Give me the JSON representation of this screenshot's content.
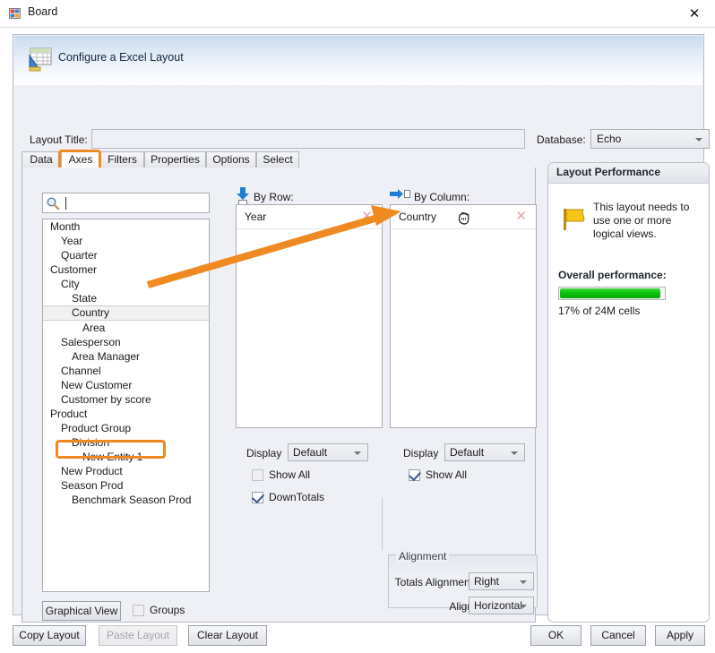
{
  "window": {
    "title": "Board",
    "icon": "board-app-icon",
    "close_label": "✕"
  },
  "banner": {
    "title": "Configure a Excel Layout",
    "icon": "excel-layout-icon"
  },
  "form": {
    "layout_title_label": "Layout Title:",
    "layout_title_value": "",
    "database_label": "Database:",
    "database_value": "Echo"
  },
  "tabs": [
    {
      "label": "Data",
      "selected": false
    },
    {
      "label": "Axes",
      "selected": true
    },
    {
      "label": "Filters",
      "selected": false
    },
    {
      "label": "Properties",
      "selected": false
    },
    {
      "label": "Options",
      "selected": false
    },
    {
      "label": "Select",
      "selected": false
    }
  ],
  "search": {
    "value": "",
    "placeholder": "",
    "icon": "magnifier-icon"
  },
  "tree": {
    "items": [
      {
        "label": "Month",
        "indent": 0,
        "selected": false
      },
      {
        "label": "Year",
        "indent": 1,
        "selected": false
      },
      {
        "label": "Quarter",
        "indent": 1,
        "selected": false
      },
      {
        "label": "Customer",
        "indent": 0,
        "selected": false
      },
      {
        "label": "City",
        "indent": 1,
        "selected": false
      },
      {
        "label": "State",
        "indent": 2,
        "selected": false
      },
      {
        "label": "Country",
        "indent": 2,
        "selected": true
      },
      {
        "label": "Area",
        "indent": 3,
        "selected": false
      },
      {
        "label": "Salesperson",
        "indent": 1,
        "selected": false
      },
      {
        "label": "Area Manager",
        "indent": 2,
        "selected": false
      },
      {
        "label": "Channel",
        "indent": 1,
        "selected": false
      },
      {
        "label": "New Customer",
        "indent": 1,
        "selected": false
      },
      {
        "label": "Customer by score",
        "indent": 1,
        "selected": false
      },
      {
        "label": "Product",
        "indent": 0,
        "selected": false
      },
      {
        "label": "Product Group",
        "indent": 1,
        "selected": false
      },
      {
        "label": "Division",
        "indent": 2,
        "selected": false
      },
      {
        "label": "New Entity 1",
        "indent": 3,
        "selected": false
      },
      {
        "label": "New Product",
        "indent": 1,
        "selected": false
      },
      {
        "label": "Season Prod",
        "indent": 1,
        "selected": false
      },
      {
        "label": "Benchmark Season Prod",
        "indent": 2,
        "selected": false
      }
    ]
  },
  "tree_footer": {
    "graphical_view_label": "Graphical View",
    "groups_label": "Groups",
    "groups_checked": false
  },
  "by_row": {
    "header": "By Row:",
    "icon": "arrow-down-to-row-icon",
    "chip_label": "Year",
    "chip_remove": "✕",
    "display_label": "Display",
    "display_value": "Default",
    "show_all_label": "Show All",
    "show_all_checked": false,
    "down_totals_label": "DownTotals",
    "down_totals_checked": true
  },
  "by_column": {
    "header": "By Column:",
    "icon": "arrow-right-to-column-icon",
    "chip_label": "Country",
    "chip_remove": "✕",
    "cursor_icon": "grab-hand-cursor-icon",
    "display_label": "Display",
    "display_value": "Default",
    "show_all_label": "Show All",
    "show_all_checked": true
  },
  "alignment": {
    "group_title": "Alignment",
    "totals_alignment_label": "Totals Alignment",
    "totals_alignment_value": "Right",
    "align_label": "Align",
    "align_value": "Horizontal"
  },
  "performance": {
    "panel_title": "Layout Performance",
    "flag_icon": "yellow-flag-icon",
    "message": "This layout needs to use one or more logical views.",
    "overall_label": "Overall performance:",
    "bar_percent": 95,
    "cells_text": "17% of 24M cells"
  },
  "footer": {
    "copy_layout": "Copy Layout",
    "paste_layout": "Paste Layout",
    "paste_layout_disabled": true,
    "clear_layout": "Clear Layout",
    "ok": "OK",
    "cancel": "Cancel",
    "apply": "Apply"
  },
  "annotation": {
    "highlight_color": "#ef8a22",
    "arrow_from": "tree-item-country",
    "arrow_to": "by-column-dropzone"
  }
}
